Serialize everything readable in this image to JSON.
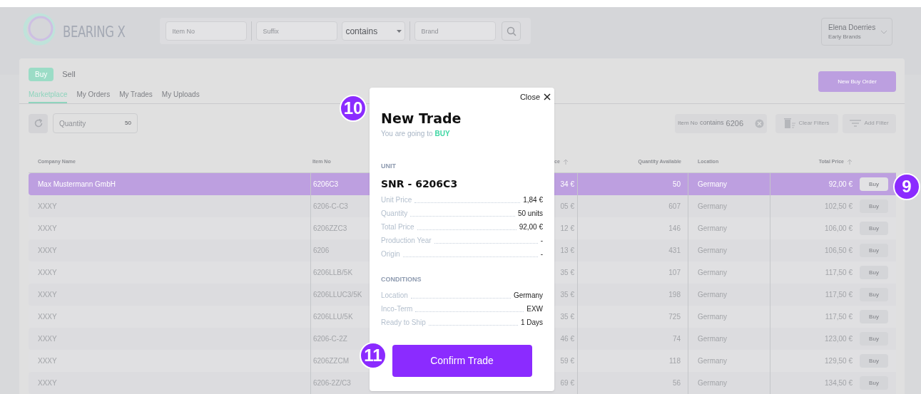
{
  "header": {
    "logo_text": "BEARING X",
    "search_fields": [
      {
        "placeholder": "Item No"
      },
      {
        "placeholder": "Suffix"
      },
      {
        "kind": "select",
        "value": "contains"
      },
      {
        "placeholder": "Brand"
      }
    ],
    "user": {
      "name": "Elena Doerries",
      "company": "Early Brands"
    }
  },
  "panel": {
    "modes": [
      {
        "label": "Buy",
        "selected": true
      },
      {
        "label": "Sell",
        "selected": false
      }
    ],
    "tabs": [
      {
        "label": "Marketplace",
        "selected": true
      },
      {
        "label": "My Orders",
        "selected": false
      },
      {
        "label": "My Trades",
        "selected": false
      },
      {
        "label": "My Uploads",
        "selected": false
      }
    ],
    "new_order_button": "New Buy Order",
    "quantity": {
      "placeholder": "Quantity",
      "value": "50"
    },
    "filter_chip": {
      "field": "Item No",
      "condition": "contains",
      "value": "6206"
    },
    "clear_filters": "Clear Filters",
    "add_filter": "Add Filter"
  },
  "table": {
    "columns": [
      {
        "label": "Company Name",
        "sorted": false
      },
      {
        "label": "Item No",
        "sorted": false
      },
      {
        "label": "ce",
        "sorted": true
      },
      {
        "label": "Quantity Available",
        "sorted": false
      },
      {
        "label": "Location",
        "sorted": false
      },
      {
        "label": "Total Price",
        "sorted": true
      }
    ],
    "rows": [
      {
        "company": "Max Mustermann GmbH",
        "item_no": "6206C3",
        "column_3": "34 €",
        "quantity": "50",
        "location": "Germany",
        "total": "92,00 €",
        "action": "Buy",
        "selected": true
      },
      {
        "company": "XXXY",
        "item_no": "6206-C-C3",
        "column_3": "05 €",
        "quantity": "607",
        "location": "Germany",
        "total": "102,50 €",
        "action": "Buy",
        "selected": false
      },
      {
        "company": "XXXY",
        "item_no": "6206ZZC3",
        "column_3": "12 €",
        "quantity": "146",
        "location": "Germany",
        "total": "106,00 €",
        "action": "Buy",
        "selected": false
      },
      {
        "company": "XXXY",
        "item_no": "6206",
        "column_3": "13 €",
        "quantity": "431",
        "location": "Germany",
        "total": "106,50 €",
        "action": "Buy",
        "selected": false
      },
      {
        "company": "XXXY",
        "item_no": "6206LLB/5K",
        "column_3": "35 €",
        "quantity": "107",
        "location": "Germany",
        "total": "117,50 €",
        "action": "Buy",
        "selected": false
      },
      {
        "company": "XXXY",
        "item_no": "6206LLUC3/5K",
        "column_3": "35 €",
        "quantity": "198",
        "location": "Germany",
        "total": "117,50 €",
        "action": "Buy",
        "selected": false
      },
      {
        "company": "XXXY",
        "item_no": "6206LLU/5K",
        "column_3": "35 €",
        "quantity": "725",
        "location": "Germany",
        "total": "117,50 €",
        "action": "Buy",
        "selected": false
      },
      {
        "company": "XXXY",
        "item_no": "6206-C-2Z",
        "column_3": "46 €",
        "quantity": "74",
        "location": "Germany",
        "total": "123,00 €",
        "action": "Buy",
        "selected": false
      },
      {
        "company": "XXXY",
        "item_no": "6206ZZCM",
        "column_3": "59 €",
        "quantity": "118",
        "location": "Germany",
        "total": "129,50 €",
        "action": "Buy",
        "selected": false
      },
      {
        "company": "XXXY",
        "item_no": "6206-2Z/C3",
        "column_3": "69 €",
        "quantity": "56",
        "location": "Germany",
        "total": "134,50 €",
        "action": "Buy",
        "selected": false
      }
    ]
  },
  "modal": {
    "close_label": "Close",
    "title": "New Trade",
    "intro": "You are going to",
    "side": "BUY",
    "unit_heading": "UNIT",
    "product": "SNR - 6206C3",
    "unit_rows": [
      {
        "label": "Unit Price",
        "value": "1,84 €"
      },
      {
        "label": "Quantity",
        "value": "50 units"
      },
      {
        "label": "Total Price",
        "value": "92,00 €"
      },
      {
        "label": "Production Year",
        "value": "-"
      },
      {
        "label": "Origin",
        "value": "-"
      }
    ],
    "conditions_heading": "CONDITIONS",
    "condition_rows": [
      {
        "label": "Location",
        "value": "Germany"
      },
      {
        "label": "Inco-Term",
        "value": "EXW"
      },
      {
        "label": "Ready to Ship",
        "value": "1 Days"
      }
    ],
    "confirm_button": "Confirm Trade"
  },
  "annotations": [
    {
      "label": "9"
    },
    {
      "label": "10"
    },
    {
      "label": "11"
    }
  ]
}
